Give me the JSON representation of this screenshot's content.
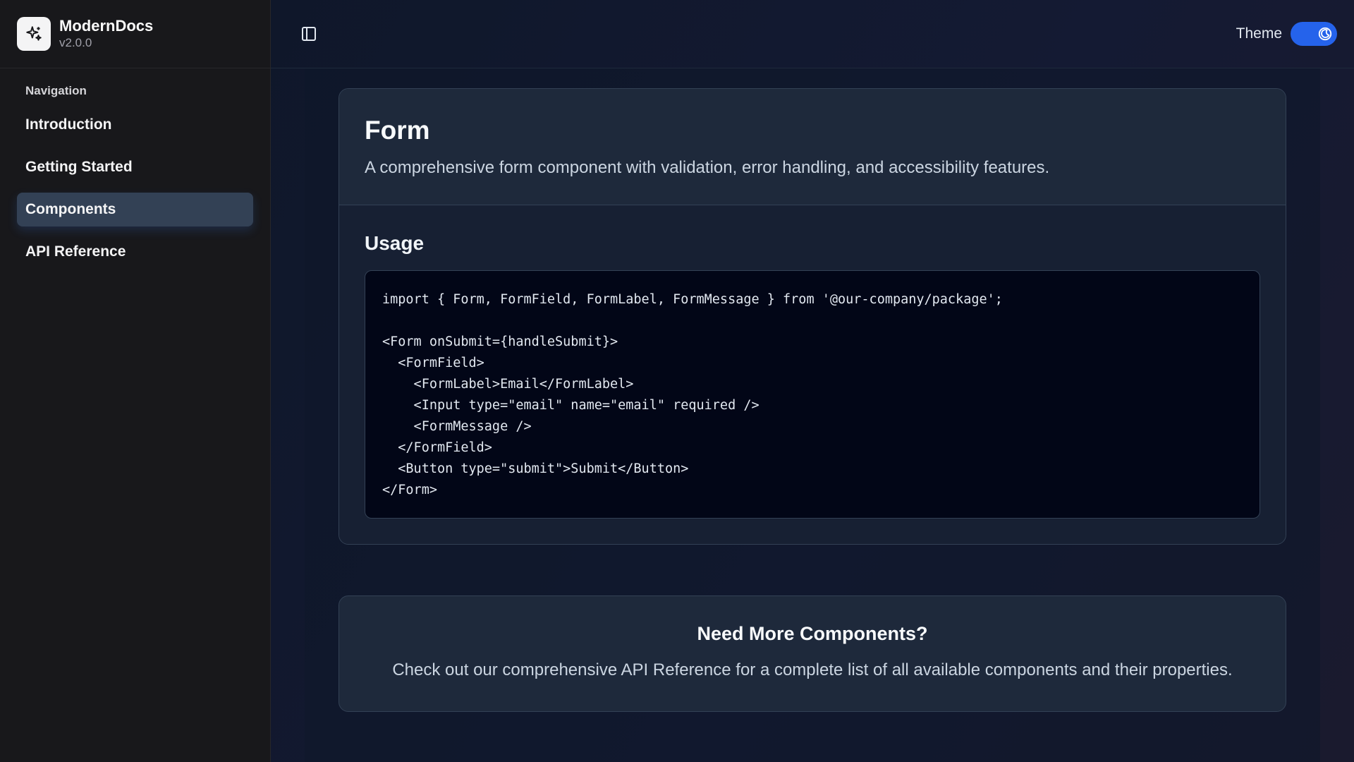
{
  "brand": {
    "name": "ModernDocs",
    "version": "v2.0.0",
    "logo_icon": "sparkles-icon"
  },
  "sidebar": {
    "heading": "Navigation",
    "items": [
      {
        "label": "Introduction",
        "active": false
      },
      {
        "label": "Getting Started",
        "active": false
      },
      {
        "label": "Components",
        "active": true
      },
      {
        "label": "API Reference",
        "active": false
      }
    ]
  },
  "topbar": {
    "toggle_sidebar_icon": "panel-left-icon",
    "theme_label": "Theme",
    "theme_toggle_icon": "moon-icon",
    "theme_mode": "dark"
  },
  "component": {
    "title": "Form",
    "description": "A comprehensive form component with validation, error handling, and accessibility features.",
    "usage_title": "Usage",
    "code_lines": [
      "import { Form, FormField, FormLabel, FormMessage } from '@our-company/package';",
      "",
      "<Form onSubmit={handleSubmit}>",
      "  <FormField>",
      "    <FormLabel>Email</FormLabel>",
      "    <Input type=\"email\" name=\"email\" required />",
      "    <FormMessage />",
      "  </FormField>",
      "  <Button type=\"submit\">Submit</Button>",
      "</Form>"
    ]
  },
  "cta": {
    "title": "Need More Components?",
    "text": "Check out our comprehensive API Reference for a complete list of all available components and their properties."
  },
  "colors": {
    "accent": "#2563eb",
    "active_nav_bg": "#334155",
    "code_bg": "#020617"
  }
}
